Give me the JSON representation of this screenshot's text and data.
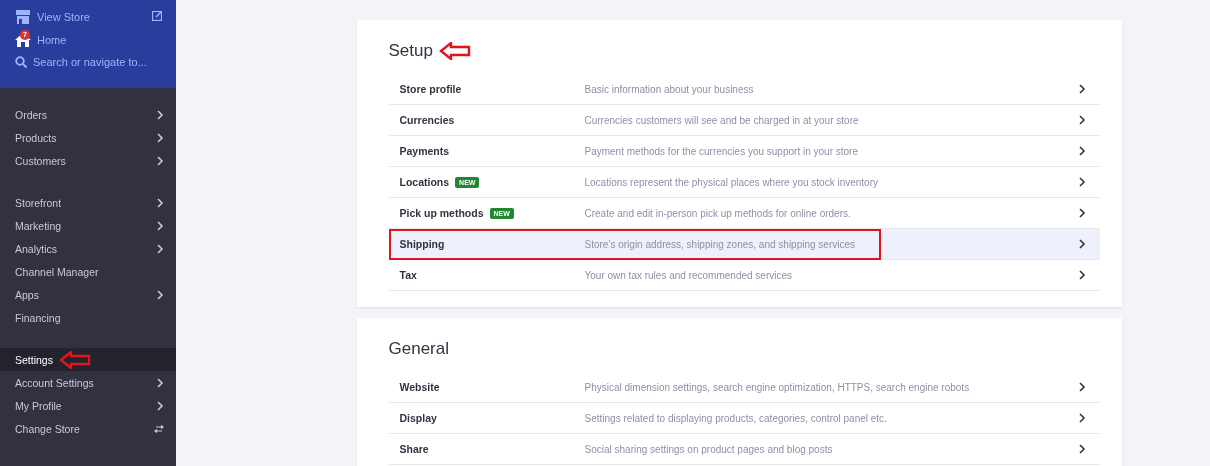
{
  "sidebar": {
    "header": {
      "view_store": "View Store",
      "home": "Home",
      "home_badge": "7",
      "search": {
        "placeholder": "Search or navigate to..."
      }
    },
    "groups": [
      [
        {
          "label": "Orders",
          "kind": "submenu",
          "selected": false,
          "annotated": false
        },
        {
          "label": "Products",
          "kind": "submenu",
          "selected": false,
          "annotated": false
        },
        {
          "label": "Customers",
          "kind": "submenu",
          "selected": false,
          "annotated": false
        }
      ],
      [
        {
          "label": "Storefront",
          "kind": "submenu",
          "selected": false,
          "annotated": false
        },
        {
          "label": "Marketing",
          "kind": "submenu",
          "selected": false,
          "annotated": false
        },
        {
          "label": "Analytics",
          "kind": "submenu",
          "selected": false,
          "annotated": false
        },
        {
          "label": "Channel Manager",
          "kind": "plain",
          "selected": false,
          "annotated": false
        },
        {
          "label": "Apps",
          "kind": "submenu",
          "selected": false,
          "annotated": false
        },
        {
          "label": "Financing",
          "kind": "plain",
          "selected": false,
          "annotated": false
        }
      ],
      [
        {
          "label": "Settings",
          "kind": "plain",
          "selected": true,
          "annotated": true
        },
        {
          "label": "Account Settings",
          "kind": "submenu",
          "selected": false,
          "annotated": false
        },
        {
          "label": "My Profile",
          "kind": "submenu",
          "selected": false,
          "annotated": false
        },
        {
          "label": "Change Store",
          "kind": "switch",
          "selected": false,
          "annotated": false
        }
      ]
    ]
  },
  "sections": [
    {
      "title": "Setup",
      "annotated": true,
      "rows": [
        {
          "name": "Store profile",
          "description": "Basic information about your business",
          "selected": false,
          "annotated": false
        },
        {
          "name": "Currencies",
          "description": "Currencies customers will see and be charged in at your store",
          "selected": false,
          "annotated": false
        },
        {
          "name": "Payments",
          "description": "Payment methods for the currencies you support in your store",
          "selected": false,
          "annotated": false
        },
        {
          "name": "Locations",
          "badge": "NEW",
          "description": "Locations represent the physical places where you stock inventory",
          "selected": false,
          "annotated": false
        },
        {
          "name": "Pick up methods",
          "badge": "NEW",
          "description": "Create and edit in-person pick up methods for online orders.",
          "selected": false,
          "annotated": false
        },
        {
          "name": "Shipping",
          "description": "Store’s origin address, shipping zones, and shipping services",
          "selected": true,
          "annotated": true
        },
        {
          "name": "Tax",
          "description": "Your own tax rules and recommended services",
          "selected": false,
          "annotated": false
        }
      ]
    },
    {
      "title": "General",
      "annotated": false,
      "rows": [
        {
          "name": "Website",
          "description": "Physical dimension settings, search engine optimization, HTTPS, search engine robots",
          "selected": false,
          "annotated": false
        },
        {
          "name": "Display",
          "description": "Settings related to displaying products, categories, control panel etc.",
          "selected": false,
          "annotated": false
        },
        {
          "name": "Share",
          "description": "Social sharing settings on product pages and blog posts",
          "selected": false,
          "annotated": false
        }
      ]
    }
  ]
}
